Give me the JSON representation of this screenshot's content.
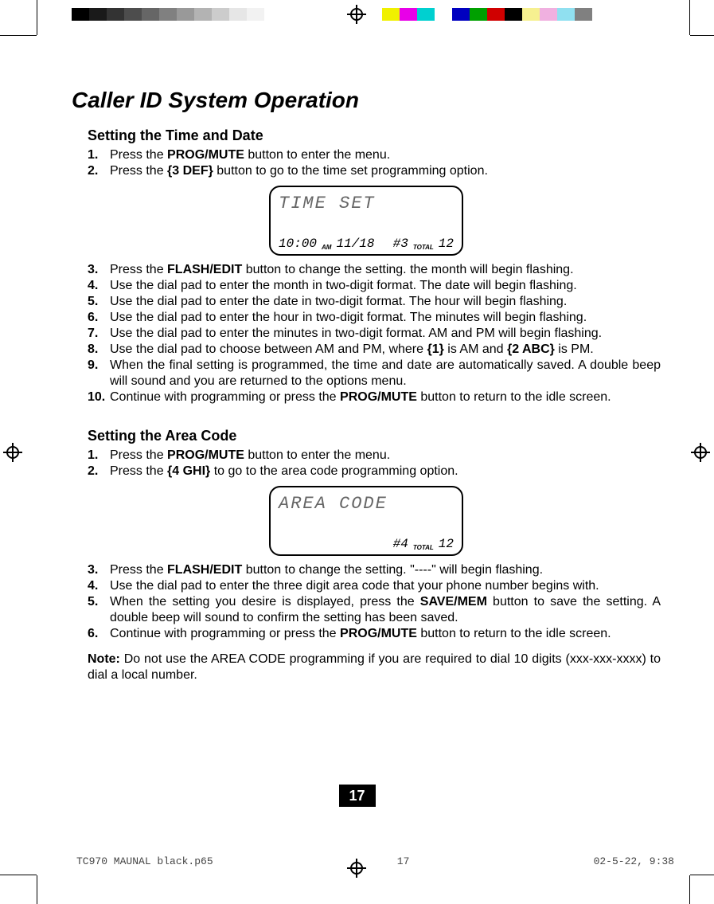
{
  "colorbar_left": [
    "#000000",
    "#1a1a1a",
    "#333333",
    "#4d4d4d",
    "#666666",
    "#808080",
    "#999999",
    "#b3b3b3",
    "#cccccc",
    "#e6e6e6",
    "#f2f2f2",
    "#ffffff"
  ],
  "colorbar_right": [
    "#f0f000",
    "#e800e8",
    "#00d0d0",
    "#ffffff",
    "#0000c0",
    "#00a000",
    "#d00000",
    "#000000",
    "#f6f090",
    "#f0b0e0",
    "#90e0f0",
    "#808080"
  ],
  "title": "Caller ID System Operation",
  "section1": {
    "heading": "Setting the Time and Date",
    "steps": [
      {
        "n": "1.",
        "pre": "Press the ",
        "b": "PROG/MUTE",
        "post": " button to enter the menu."
      },
      {
        "n": "2.",
        "pre": "Press the ",
        "b": "{3 DEF}",
        "post": " button  to go to the time set programming option."
      }
    ],
    "lcd": {
      "line1": "TIME SET",
      "time": "10:00",
      "ampm": "AM",
      "date": "11/18",
      "hash": "#3",
      "total_label": "TOTAL",
      "total": "12"
    },
    "steps_b": [
      {
        "n": "3.",
        "pre": "Press the ",
        "b": "FLASH/EDIT",
        "post": " button to change the setting. the month  will begin flashing."
      },
      {
        "n": "4.",
        "pre": "Use the dial pad  to enter the month in two-digit format. The date will begin flashing.",
        "b": "",
        "post": ""
      },
      {
        "n": "5.",
        "pre": "Use the dial pad  to enter the date in two-digit format. The hour  will begin flashing.",
        "b": "",
        "post": ""
      },
      {
        "n": "6.",
        "pre": "Use the dial pad  to enter the hour in two-digit format. The minutes will begin flashing.",
        "b": "",
        "post": ""
      },
      {
        "n": "7.",
        "pre": "Use the dial pad  to enter the minutes in two-digit format. AM and PM will begin flashing.",
        "b": "",
        "post": ""
      },
      {
        "n": "8.",
        "pre": "Use the dial pad  to choose between AM and PM, where ",
        "b": "{1}",
        "post": " is AM and ",
        "b2": "{2 ABC}",
        "post2": " is PM."
      },
      {
        "n": "9.",
        "pre": "When the final setting is programmed, the time and date are automatically saved. A double beep will sound and you are returned to the options menu.",
        "b": "",
        "post": ""
      },
      {
        "n": "10.",
        "pre": "Continue with programming or press the ",
        "b": "PROG/MUTE",
        "post": " button to return to the idle screen."
      }
    ]
  },
  "section2": {
    "heading": "Setting the Area Code",
    "steps": [
      {
        "n": "1.",
        "pre": "Press the ",
        "b": "PROG/MUTE",
        "post": " button to enter the menu."
      },
      {
        "n": "2.",
        "pre": "Press the ",
        "b": "{4 GHI}",
        "post": " to go to the area code programming option."
      }
    ],
    "lcd": {
      "line1": "AREA CODE",
      "hash": "#4",
      "total_label": "TOTAL",
      "total": "12"
    },
    "steps_b": [
      {
        "n": "3.",
        "pre": "Press the ",
        "b": "FLASH/EDIT",
        "post": " button to change the setting. \"----\" will begin flashing."
      },
      {
        "n": "4.",
        "pre": "Use the dial pad to enter the three digit area code that your phone number begins with.",
        "b": "",
        "post": ""
      },
      {
        "n": "5.",
        "pre": "When the setting you desire is displayed, press the ",
        "b": "SAVE/MEM",
        "post": " button to save the setting. A double beep will sound to confirm the setting has been saved."
      },
      {
        "n": "6.",
        "pre": "Continue with programming or press the ",
        "b": "PROG/MUTE",
        "post": " button to return to the idle screen."
      }
    ],
    "note_label": "Note:",
    "note": " Do not use the AREA CODE programming if you are required to dial 10 digits (xxx-xxx-xxxx) to dial a local number."
  },
  "page_number": "17",
  "footer": {
    "file": "TC970 MAUNAL black.p65",
    "page": "17",
    "date": "02-5-22, 9:38"
  }
}
